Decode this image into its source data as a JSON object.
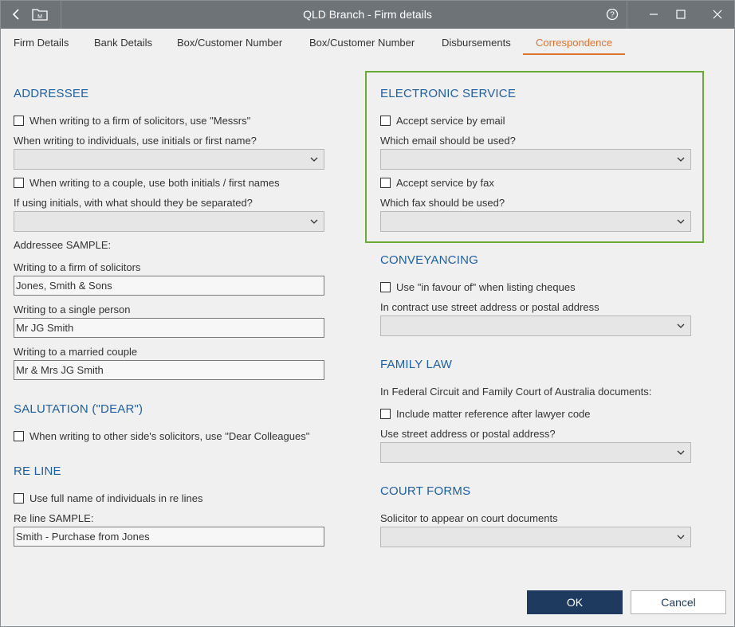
{
  "window": {
    "title": "QLD Branch - Firm details"
  },
  "tabs": [
    {
      "label": "Firm Details"
    },
    {
      "label": "Bank Details"
    },
    {
      "label": "Box/Customer Number"
    },
    {
      "label": "Box/Customer Number"
    },
    {
      "label": "Disbursements"
    },
    {
      "label": "Correspondence",
      "active": true
    }
  ],
  "left": {
    "addressee": {
      "heading": "ADDRESSEE",
      "messrs_label": "When writing to a firm of solicitors, use \"Messrs\"",
      "messrs_checked": false,
      "individuals_label": "When writing to individuals, use initials or first name?",
      "individuals_value": "",
      "couple_label": "When writing to a couple, use both initials / first names",
      "couple_checked": false,
      "separator_label": "If using initials, with what should they be separated?",
      "separator_value": "",
      "sample_label": "Addressee SAMPLE:",
      "firm_label": "Writing to a firm of solicitors",
      "firm_value": "Jones, Smith & Sons",
      "single_label": "Writing to a single person",
      "single_value": "Mr JG Smith",
      "married_label": "Writing to a married couple",
      "married_value": "Mr & Mrs JG Smith"
    },
    "salutation": {
      "heading": "SALUTATION (\"DEAR\")",
      "colleagues_label": "When writing to other side's solicitors, use \"Dear Colleagues\"",
      "colleagues_checked": false
    },
    "reline": {
      "heading": "RE LINE",
      "fullname_label": "Use full name of individuals in re lines",
      "fullname_checked": false,
      "sample_label": "Re line SAMPLE:",
      "sample_value": "Smith - Purchase from Jones"
    }
  },
  "right": {
    "electronic": {
      "heading": "ELECTRONIC SERVICE",
      "email_label": "Accept service by email",
      "email_checked": false,
      "which_email_label": "Which email should be used?",
      "which_email_value": "",
      "fax_label": "Accept service by fax",
      "fax_checked": false,
      "which_fax_label": "Which fax should be used?",
      "which_fax_value": ""
    },
    "conveyancing": {
      "heading": "CONVEYANCING",
      "favour_label": "Use \"in favour of\" when listing cheques",
      "favour_checked": false,
      "contract_label": "In contract use street address or postal address",
      "contract_value": ""
    },
    "family": {
      "heading": "FAMILY LAW",
      "intro_label": "In Federal Circuit and Family Court of Australia documents:",
      "matter_label": "Include matter reference after lawyer code",
      "matter_checked": false,
      "address_label": "Use street address or postal address?",
      "address_value": ""
    },
    "court": {
      "heading": "COURT FORMS",
      "solicitor_label": "Solicitor to appear on court documents",
      "solicitor_value": ""
    }
  },
  "footer": {
    "ok_label": "OK",
    "cancel_label": "Cancel"
  },
  "colors": {
    "accent": "#e2732f",
    "heading": "#1f5fa3",
    "highlight": "#6aab37",
    "primary_button": "#1e3a5f"
  },
  "icons": [
    "back-arrow-icon",
    "matter-folder-icon",
    "help-icon",
    "minimize-icon",
    "maximize-icon",
    "close-icon",
    "chevron-down-icon"
  ]
}
